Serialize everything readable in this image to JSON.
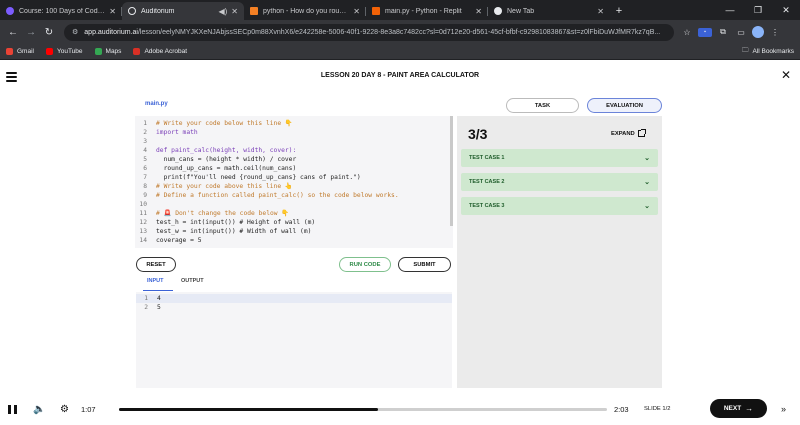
{
  "browser": {
    "tabs": [
      {
        "title": "Course: 100 Days of Code: The",
        "color": "#7c5cff",
        "active": false
      },
      {
        "title": "Auditorium",
        "color": "#e8eaed",
        "active": true
      },
      {
        "title": "python - How do you round UP",
        "color": "#f48024",
        "active": false
      },
      {
        "title": "main.py - Python - Replit",
        "color": "#f26207",
        "active": false
      },
      {
        "title": "New Tab",
        "color": "#e8eaed",
        "active": false
      }
    ],
    "new_tab_glyph": "+",
    "url_host": "app.auditorium.ai",
    "url_path": "/lesson/eelyNMYJKXeNJAbjssSECp0m88XvnhX6/e242258e-5006-40f1-9228-8e3a8c7482cc?sl=0d712e20-d561-45cf-bfbf-c92981083867&st=z0lFbiDuWJfMR7kz7qB...",
    "bookmarks": [
      {
        "label": "Gmail",
        "color": "#ea4335"
      },
      {
        "label": "YouTube",
        "color": "#ff0000"
      },
      {
        "label": "Maps",
        "color": "#34a853"
      },
      {
        "label": "Adobe Acrobat",
        "color": "#d93025"
      }
    ],
    "all_bookmarks": "All Bookmarks"
  },
  "header": {
    "lesson_title": "LESSON 20 DAY 8 - PAINT AREA CALCULATOR"
  },
  "editor": {
    "file_tab": "main.py",
    "lines": [
      {
        "n": "1",
        "text": "# Write your code below this line 👇",
        "kind": "com"
      },
      {
        "n": "2",
        "text": "import math",
        "kind": "kw"
      },
      {
        "n": "3",
        "text": "",
        "kind": "plain"
      },
      {
        "n": "4",
        "text": "def paint_calc(height, width, cover):",
        "kind": "def"
      },
      {
        "n": "5",
        "text": "  num_cans = (height * width) / cover",
        "kind": "plain"
      },
      {
        "n": "6",
        "text": "  round_up_cans = math.ceil(num_cans)",
        "kind": "plain"
      },
      {
        "n": "7",
        "text": "  print(f\"You'll need {round_up_cans} cans of paint.\")",
        "kind": "print"
      },
      {
        "n": "8",
        "text": "# Write your code above this line 👆",
        "kind": "com"
      },
      {
        "n": "9",
        "text": "# Define a function called paint_calc() so the code below works.",
        "kind": "com"
      },
      {
        "n": "10",
        "text": "",
        "kind": "plain"
      },
      {
        "n": "11",
        "text": "# 🚨 Don't change the code below 👇",
        "kind": "com"
      },
      {
        "n": "12",
        "text": "test_h = int(input()) # Height of wall (m)",
        "kind": "mixed"
      },
      {
        "n": "13",
        "text": "test_w = int(input()) # Width of wall (m)",
        "kind": "mixed"
      },
      {
        "n": "14",
        "text": "coverage = 5",
        "kind": "plain"
      }
    ]
  },
  "actions": {
    "reset": "RESET",
    "run_code": "RUN CODE",
    "submit": "SUBMIT"
  },
  "io": {
    "input_tab": "INPUT",
    "output_tab": "OUTPUT",
    "lines": [
      {
        "n": "1",
        "text": "4"
      },
      {
        "n": "2",
        "text": "5"
      }
    ]
  },
  "right": {
    "task_tab": "TASK",
    "evaluation_tab": "EVALUATION",
    "score": "3/3",
    "expand": "EXPAND",
    "test_cases": [
      "TEST CASE 1",
      "TEST CASE 2",
      "TEST CASE 3"
    ]
  },
  "player": {
    "elapsed": "1:07",
    "duration": "2:03",
    "progress": 0.53,
    "slide": "SLIDE 1/2",
    "next": "NEXT"
  },
  "colors": {
    "accent": "#3b62d6",
    "pass_bg": "#cfe8cf",
    "pass_text": "#1f5d2b"
  }
}
